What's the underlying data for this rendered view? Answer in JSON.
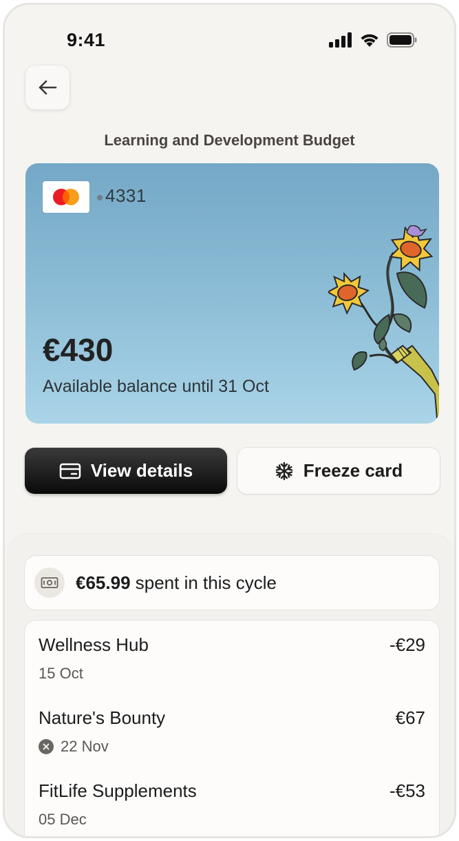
{
  "status_bar": {
    "time": "9:41",
    "icons": [
      "cellular-signal-icon",
      "wifi-icon",
      "battery-icon"
    ]
  },
  "header": {
    "back_icon": "arrow-left-icon",
    "title": "Learning and Development Budget"
  },
  "card": {
    "brand_icon": "mastercard-logo",
    "last_four": "4331",
    "balance": "€430",
    "subtitle": "Available balance until 31 Oct",
    "illustration": "sunflowers-watering-can-illustration",
    "colors": {
      "top": "#74a8c6",
      "bottom": "#aad4e8"
    }
  },
  "actions": {
    "view_details": {
      "label": "View details",
      "icon": "card-icon"
    },
    "freeze_card": {
      "label": "Freeze card",
      "icon": "snowflake-icon"
    }
  },
  "spending": {
    "icon": "banknote-icon",
    "amount": "€65.99",
    "label": " spent in this cycle"
  },
  "transactions": [
    {
      "name": "Wellness Hub",
      "amount": "-€29",
      "date": "15 Oct",
      "status": ""
    },
    {
      "name": "Nature's Bounty",
      "amount": "€67",
      "date": "22 Nov",
      "status": "cancelled"
    },
    {
      "name": "FitLife Supplements",
      "amount": "-€53",
      "date": "05 Dec",
      "status": ""
    }
  ]
}
